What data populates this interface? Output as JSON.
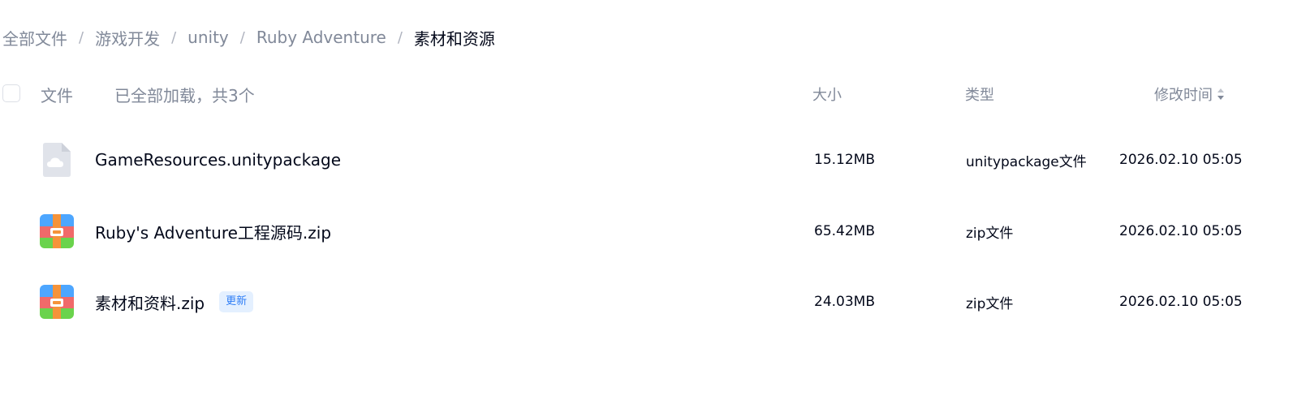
{
  "breadcrumb": {
    "items": [
      "全部文件",
      "游戏开发",
      "unity",
      "Ruby Adventure"
    ],
    "current": "素材和资源",
    "separator": "/"
  },
  "header": {
    "file_label": "文件",
    "loaded_status": "已全部加载，共3个",
    "size_label": "大小",
    "type_label": "类型",
    "time_label": "修改时间"
  },
  "files": [
    {
      "name": "GameResources.unitypackage",
      "icon": "cloud-file-icon",
      "badge": "",
      "size": "15.12MB",
      "type": "unitypackage文件",
      "modified": "2026.02.10 05:05"
    },
    {
      "name": "Ruby's Adventure工程源码.zip",
      "icon": "zip-archive-icon",
      "badge": "",
      "size": "65.42MB",
      "type": "zip文件",
      "modified": "2026.02.10 05:05"
    },
    {
      "name": "素材和资料.zip",
      "icon": "zip-archive-icon",
      "badge": "更新",
      "size": "24.03MB",
      "type": "zip文件",
      "modified": "2026.02.10 05:05"
    }
  ],
  "colors": {
    "text_primary": "#03081a",
    "text_secondary": "#818999",
    "badge_text": "#2f7ef6",
    "badge_bg": "#e4f0ff",
    "zip_blue": "#4da6ff",
    "zip_red": "#f06a6a",
    "zip_green": "#6ad34c",
    "zip_orange": "#f5933a",
    "cloud_file_bg": "#e0e3ea"
  }
}
